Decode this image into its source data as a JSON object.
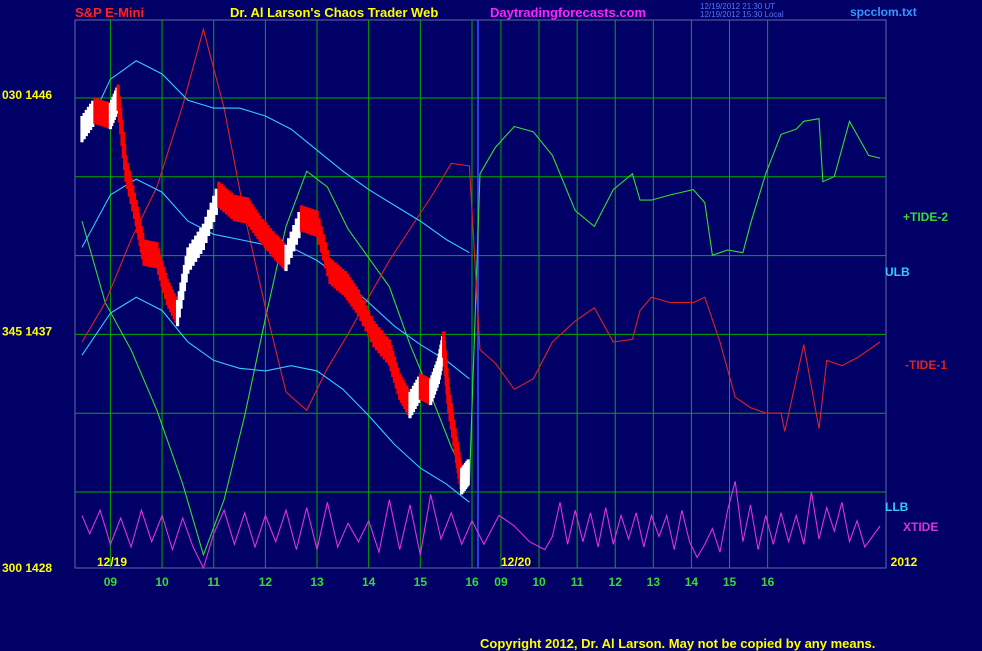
{
  "header": {
    "symbol": "S&P E-Mini",
    "title": "Dr. Al Larson's Chaos Trader Web",
    "site": "Daytradingforecasts.com",
    "timestamp_ut": "12/19/2012 21:30 UT",
    "timestamp_local": "12/19/2012 15:30 Local",
    "file": "spcclom.txt"
  },
  "colors": {
    "background": "#000066",
    "grid": "#00aa00",
    "price_up": "#ffffff",
    "price_down": "#ff0000",
    "tide_plus": "#33dd33",
    "tide_minus": "#dd2222",
    "bands": "#33ccff",
    "xtide": "#dd33dd",
    "fast_ma": "#ffff00"
  },
  "chart_data": {
    "type": "line",
    "title": "S&P E-Mini",
    "ylim": [
      1428,
      1449
    ],
    "yticks": [
      {
        "value": 1446,
        "label": "030  1446"
      },
      {
        "value": 1437,
        "label": "345  1437"
      },
      {
        "value": 1428,
        "label": "300  1428"
      }
    ],
    "xlim": [
      8.45,
      16.1
    ],
    "x_unit": "hour (12/19 session, then 12/20 forecast)",
    "xticks": [
      "09",
      "10",
      "11",
      "12",
      "13",
      "14",
      "15",
      "16",
      "09",
      "10",
      "11",
      "12",
      "13",
      "14",
      "15",
      "16"
    ],
    "date_labels": [
      "12/19",
      "12/20",
      "2012"
    ],
    "split_date": "12/20",
    "series": [
      {
        "name": "+TIDE-2",
        "points": [
          [
            8.45,
            1441.2
          ],
          [
            8.9,
            1438.1
          ],
          [
            9.4,
            1436.3
          ],
          [
            9.9,
            1434.0
          ],
          [
            10.4,
            1431.2
          ],
          [
            10.8,
            1428.5
          ],
          [
            11.2,
            1430.6
          ],
          [
            11.6,
            1433.8
          ],
          [
            12.0,
            1437.5
          ],
          [
            12.4,
            1441.0
          ],
          [
            12.8,
            1443.1
          ],
          [
            13.2,
            1442.5
          ],
          [
            13.6,
            1440.9
          ],
          [
            14.0,
            1439.8
          ],
          [
            14.4,
            1438.7
          ],
          [
            14.8,
            1436.5
          ],
          [
            15.2,
            1434.6
          ],
          [
            15.6,
            1432.6
          ],
          [
            15.95,
            1431.2
          ],
          [
            16.1,
            1443.0
          ],
          [
            16.5,
            1444.0
          ],
          [
            17.0,
            1444.8
          ],
          [
            17.5,
            1444.6
          ],
          [
            18.0,
            1443.7
          ],
          [
            18.6,
            1441.6
          ],
          [
            19.1,
            1441.0
          ],
          [
            19.6,
            1442.4
          ],
          [
            20.1,
            1443.0
          ],
          [
            20.3,
            1442.0
          ],
          [
            20.6,
            1442.0
          ],
          [
            21.1,
            1442.2
          ],
          [
            21.7,
            1442.4
          ],
          [
            22.0,
            1441.9
          ],
          [
            22.2,
            1439.9
          ],
          [
            22.6,
            1440.1
          ],
          [
            23.0,
            1440.0
          ],
          [
            23.2,
            1441.1
          ],
          [
            23.6,
            1443.0
          ],
          [
            24.0,
            1444.5
          ],
          [
            24.4,
            1444.7
          ],
          [
            24.6,
            1445.0
          ],
          [
            25.0,
            1445.1
          ],
          [
            25.1,
            1442.7
          ],
          [
            25.4,
            1442.9
          ],
          [
            25.8,
            1445.0
          ],
          [
            26.3,
            1443.7
          ],
          [
            26.6,
            1443.6
          ]
        ]
      },
      {
        "name": "-TIDE-1",
        "points": [
          [
            8.45,
            1436.6
          ],
          [
            8.9,
            1438.1
          ],
          [
            9.4,
            1440.5
          ],
          [
            9.9,
            1442.5
          ],
          [
            10.4,
            1445.6
          ],
          [
            10.8,
            1448.5
          ],
          [
            11.2,
            1445.5
          ],
          [
            11.6,
            1441.4
          ],
          [
            12.0,
            1437.9
          ],
          [
            12.4,
            1434.7
          ],
          [
            12.8,
            1434.0
          ],
          [
            13.2,
            1435.6
          ],
          [
            13.6,
            1436.9
          ],
          [
            14.0,
            1438.3
          ],
          [
            14.4,
            1439.7
          ],
          [
            14.8,
            1440.9
          ],
          [
            15.2,
            1442.1
          ],
          [
            15.6,
            1443.4
          ],
          [
            15.95,
            1443.3
          ],
          [
            16.1,
            1436.3
          ],
          [
            16.5,
            1435.8
          ],
          [
            17.0,
            1434.8
          ],
          [
            17.5,
            1435.2
          ],
          [
            18.0,
            1436.6
          ],
          [
            18.6,
            1437.4
          ],
          [
            19.1,
            1437.9
          ],
          [
            19.6,
            1436.6
          ],
          [
            20.1,
            1436.7
          ],
          [
            20.3,
            1437.8
          ],
          [
            20.6,
            1438.3
          ],
          [
            21.1,
            1438.1
          ],
          [
            21.7,
            1438.1
          ],
          [
            22.0,
            1438.3
          ],
          [
            22.4,
            1436.6
          ],
          [
            22.8,
            1434.5
          ],
          [
            23.2,
            1434.1
          ],
          [
            23.6,
            1433.9
          ],
          [
            24.0,
            1433.9
          ],
          [
            24.1,
            1433.2
          ],
          [
            24.6,
            1436.5
          ],
          [
            25.0,
            1433.3
          ],
          [
            25.2,
            1435.9
          ],
          [
            25.6,
            1435.7
          ],
          [
            26.0,
            1436.0
          ],
          [
            26.6,
            1436.6
          ]
        ]
      },
      {
        "name": "ULB",
        "points": [
          [
            8.45,
            1444.3
          ],
          [
            9.0,
            1446.6
          ],
          [
            9.5,
            1447.3
          ],
          [
            10.0,
            1446.8
          ],
          [
            10.5,
            1445.8
          ],
          [
            11.0,
            1445.5
          ],
          [
            11.5,
            1445.5
          ],
          [
            12.0,
            1445.2
          ],
          [
            12.5,
            1444.7
          ],
          [
            13.0,
            1443.9
          ],
          [
            13.5,
            1443.1
          ],
          [
            14.0,
            1442.4
          ],
          [
            14.5,
            1441.8
          ],
          [
            15.0,
            1441.2
          ],
          [
            15.5,
            1440.5
          ],
          [
            15.95,
            1440.0
          ]
        ]
      },
      {
        "name": "LLB",
        "points": [
          [
            8.45,
            1436.1
          ],
          [
            9.0,
            1437.7
          ],
          [
            9.5,
            1438.3
          ],
          [
            10.0,
            1437.8
          ],
          [
            10.5,
            1436.6
          ],
          [
            11.0,
            1435.9
          ],
          [
            11.5,
            1435.6
          ],
          [
            12.0,
            1435.5
          ],
          [
            12.5,
            1435.7
          ],
          [
            13.0,
            1435.5
          ],
          [
            13.5,
            1434.8
          ],
          [
            14.0,
            1433.8
          ],
          [
            14.5,
            1432.7
          ],
          [
            15.0,
            1431.8
          ],
          [
            15.5,
            1431.2
          ],
          [
            15.95,
            1430.5
          ]
        ]
      },
      {
        "name": "Mid Band",
        "points": [
          [
            8.45,
            1440.2
          ],
          [
            9.0,
            1442.2
          ],
          [
            9.5,
            1442.8
          ],
          [
            10.0,
            1442.3
          ],
          [
            10.5,
            1441.2
          ],
          [
            11.0,
            1440.7
          ],
          [
            11.5,
            1440.5
          ],
          [
            12.0,
            1440.3
          ],
          [
            12.5,
            1440.2
          ],
          [
            13.0,
            1439.7
          ],
          [
            13.5,
            1439.0
          ],
          [
            14.0,
            1438.1
          ],
          [
            14.5,
            1437.2
          ],
          [
            15.0,
            1436.5
          ],
          [
            15.5,
            1435.9
          ],
          [
            15.95,
            1435.2
          ]
        ]
      },
      {
        "name": "XTIDE",
        "points": [
          [
            8.45,
            1430.0
          ],
          [
            8.6,
            1429.3
          ],
          [
            8.8,
            1430.2
          ],
          [
            9.0,
            1428.9
          ],
          [
            9.2,
            1429.9
          ],
          [
            9.4,
            1428.8
          ],
          [
            9.6,
            1430.2
          ],
          [
            9.8,
            1429.0
          ],
          [
            10.0,
            1430.0
          ],
          [
            10.2,
            1428.7
          ],
          [
            10.4,
            1429.9
          ],
          [
            10.6,
            1428.8
          ],
          [
            10.8,
            1428.0
          ],
          [
            11.0,
            1429.3
          ],
          [
            11.2,
            1430.2
          ],
          [
            11.4,
            1428.9
          ],
          [
            11.6,
            1430.1
          ],
          [
            11.8,
            1428.8
          ],
          [
            12.0,
            1430.0
          ],
          [
            12.2,
            1429.0
          ],
          [
            12.4,
            1430.2
          ],
          [
            12.6,
            1428.7
          ],
          [
            12.8,
            1430.3
          ],
          [
            13.0,
            1428.7
          ],
          [
            13.2,
            1430.5
          ],
          [
            13.4,
            1428.8
          ],
          [
            13.6,
            1429.7
          ],
          [
            13.8,
            1429.0
          ],
          [
            14.0,
            1429.8
          ],
          [
            14.2,
            1428.6
          ],
          [
            14.4,
            1430.6
          ],
          [
            14.6,
            1428.7
          ],
          [
            14.8,
            1430.4
          ],
          [
            15.0,
            1428.5
          ],
          [
            15.2,
            1430.8
          ],
          [
            15.4,
            1429.1
          ],
          [
            15.6,
            1430.1
          ],
          [
            15.8,
            1428.9
          ],
          [
            16.0,
            1429.8
          ],
          [
            16.2,
            1428.9
          ],
          [
            16.6,
            1430.0
          ],
          [
            17.0,
            1429.6
          ],
          [
            17.4,
            1429.0
          ],
          [
            17.8,
            1428.7
          ],
          [
            18.0,
            1429.2
          ],
          [
            18.2,
            1430.5
          ],
          [
            18.4,
            1428.9
          ],
          [
            18.6,
            1430.2
          ],
          [
            18.8,
            1429.0
          ],
          [
            19.0,
            1430.1
          ],
          [
            19.2,
            1428.8
          ],
          [
            19.4,
            1430.3
          ],
          [
            19.6,
            1428.9
          ],
          [
            19.8,
            1430.0
          ],
          [
            20.0,
            1429.1
          ],
          [
            20.2,
            1430.1
          ],
          [
            20.4,
            1428.8
          ],
          [
            20.6,
            1430.0
          ],
          [
            20.8,
            1429.2
          ],
          [
            21.0,
            1430.0
          ],
          [
            21.2,
            1428.7
          ],
          [
            21.4,
            1430.2
          ],
          [
            21.6,
            1429.0
          ],
          [
            21.8,
            1428.4
          ],
          [
            22.0,
            1428.9
          ],
          [
            22.2,
            1429.5
          ],
          [
            22.4,
            1428.6
          ],
          [
            22.6,
            1430.2
          ],
          [
            22.8,
            1431.3
          ],
          [
            23.0,
            1429.0
          ],
          [
            23.2,
            1430.4
          ],
          [
            23.4,
            1428.7
          ],
          [
            23.6,
            1430.0
          ],
          [
            23.8,
            1428.9
          ],
          [
            24.0,
            1430.1
          ],
          [
            24.2,
            1429.0
          ],
          [
            24.4,
            1430.0
          ],
          [
            24.6,
            1428.9
          ],
          [
            24.8,
            1430.9
          ],
          [
            25.0,
            1429.1
          ],
          [
            25.2,
            1430.3
          ],
          [
            25.4,
            1429.4
          ],
          [
            25.6,
            1430.5
          ],
          [
            25.8,
            1429.0
          ],
          [
            26.0,
            1429.8
          ],
          [
            26.2,
            1428.8
          ],
          [
            26.6,
            1429.6
          ]
        ]
      },
      {
        "name": "Price",
        "points": [
          [
            8.45,
            1444.7
          ],
          [
            8.7,
            1445.4
          ],
          [
            9.0,
            1445.2
          ],
          [
            9.15,
            1445.9
          ],
          [
            9.3,
            1443.2
          ],
          [
            9.5,
            1441.5
          ],
          [
            9.65,
            1440.0
          ],
          [
            9.9,
            1439.9
          ],
          [
            10.1,
            1438.5
          ],
          [
            10.3,
            1437.7
          ],
          [
            10.5,
            1439.7
          ],
          [
            10.8,
            1440.6
          ],
          [
            11.1,
            1442.2
          ],
          [
            11.4,
            1441.7
          ],
          [
            11.65,
            1441.6
          ],
          [
            11.9,
            1440.9
          ],
          [
            12.2,
            1440.2
          ],
          [
            12.4,
            1439.8
          ],
          [
            12.7,
            1441.3
          ],
          [
            13.0,
            1441.1
          ],
          [
            13.25,
            1439.3
          ],
          [
            13.55,
            1438.8
          ],
          [
            13.8,
            1438.1
          ],
          [
            14.1,
            1436.9
          ],
          [
            14.4,
            1436.2
          ],
          [
            14.6,
            1434.9
          ],
          [
            14.8,
            1434.2
          ],
          [
            15.0,
            1434.9
          ],
          [
            15.2,
            1434.7
          ],
          [
            15.35,
            1435.5
          ],
          [
            15.45,
            1436.5
          ],
          [
            15.55,
            1434.4
          ],
          [
            15.7,
            1432.5
          ],
          [
            15.8,
            1431.3
          ],
          [
            15.95,
            1431.7
          ]
        ]
      }
    ]
  },
  "legend": {
    "tide_plus": "+TIDE-2",
    "ulb": "ULB",
    "tide_minus": "-TIDE-1",
    "llb": "LLB",
    "xtide": "XTIDE"
  },
  "footer": {
    "copyright": "Copyright 2012, Dr. Al Larson. May not be copied by any means."
  }
}
